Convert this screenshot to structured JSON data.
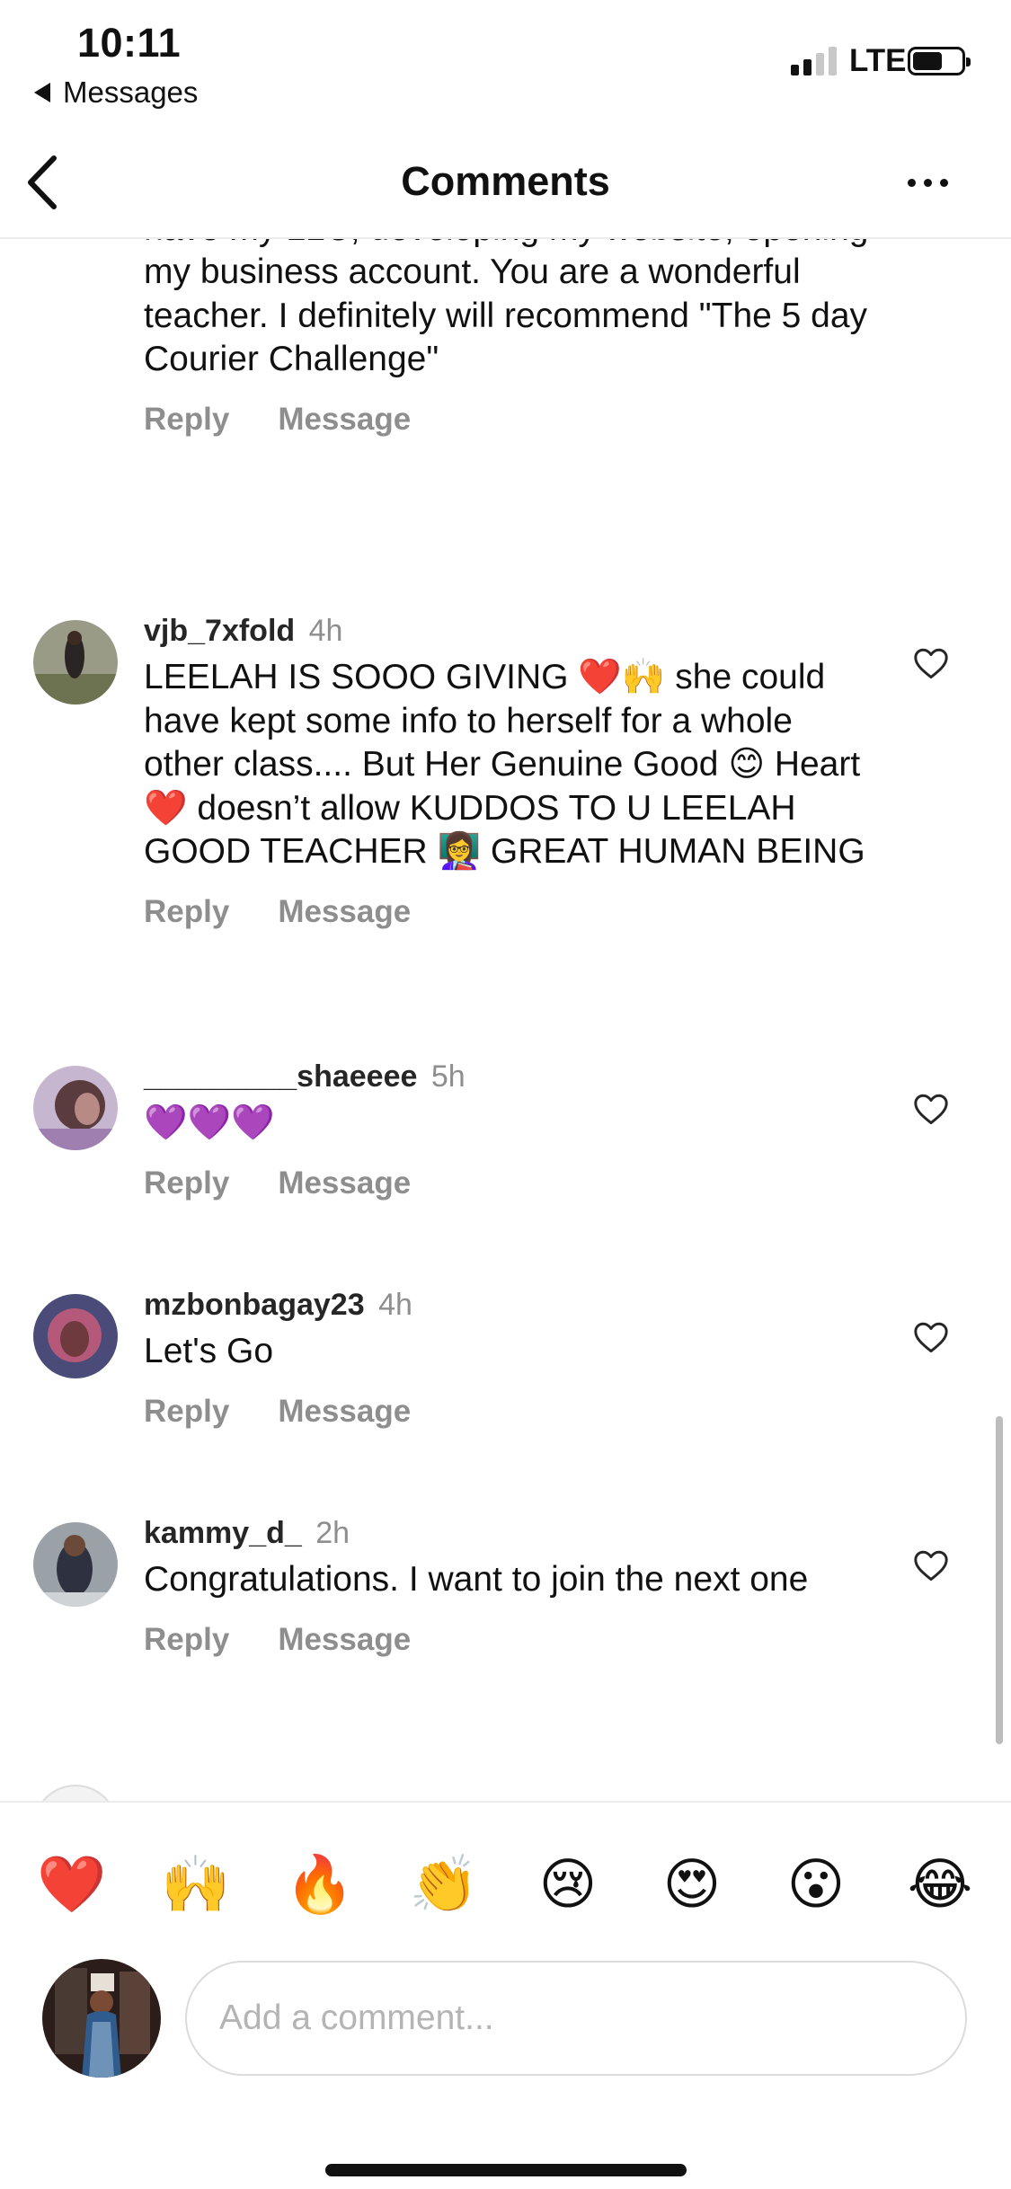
{
  "status_bar": {
    "time": "10:11",
    "back_app": "Messages",
    "network": "LTE",
    "signal_bars": 2,
    "signal_bars_total": 4,
    "battery_level": 0.62
  },
  "nav": {
    "title": "Comments"
  },
  "comments": [
    {
      "username": "",
      "time": "",
      "text": "I want to thank you!!! The class motivated me, I have my LLC, developing my website, opening my business account. You are a wonderful teacher. I definitely will recommend \"The 5 day Courier Challenge\"",
      "reply": "Reply",
      "message": "Message"
    },
    {
      "username": "vjb_7xfold",
      "time": "4h",
      "text": "LEELAH IS SOOO GIVING ❤️🙌 she could have kept some info to herself for a whole other class.... But Her Genuine Good 😊 Heart ❤️ doesn’t allow KUDDOS TO U LEELAH GOOD TEACHER 👩‍🏫 GREAT HUMAN BEING",
      "reply": "Reply",
      "message": "Message"
    },
    {
      "username": "_________shaeeee",
      "time": "5h",
      "text": "💜💜💜",
      "reply": "Reply",
      "message": "Message"
    },
    {
      "username": "mzbonbagay23",
      "time": "4h",
      "text": "Let's Go",
      "reply": "Reply",
      "message": "Message"
    },
    {
      "username": "kammy_d_",
      "time": "2h",
      "text": "Congratulations. I want to join the next one",
      "reply": "Reply",
      "message": "Message"
    }
  ],
  "emoji_bar": [
    "❤️",
    "🙌",
    "🔥",
    "👏",
    "😢",
    "😍",
    "😮",
    "😂"
  ],
  "composer": {
    "placeholder": "Add a comment..."
  },
  "colors": {
    "text": "#111111",
    "secondary": "#8e8e8e",
    "divider": "#ebebeb",
    "placeholder": "#b4b4b4"
  }
}
